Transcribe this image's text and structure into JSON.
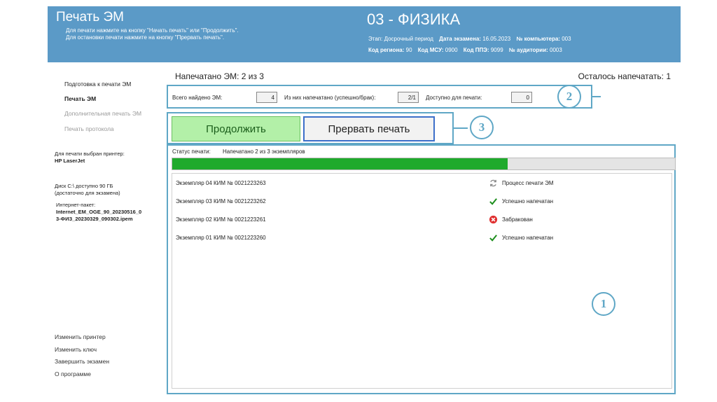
{
  "header": {
    "title": "Печать ЭМ",
    "hint_line1": "Для печати нажмите на кнопку \"Начать печать\" или \"Продолжить\".",
    "hint_line2": "Для остановки печати нажмите на кнопку \"Прервать печать\".",
    "subject": "03 - ФИЗИКА",
    "stage_label": "Этап:",
    "stage_value": "Досрочный период",
    "exam_date_label": "Дата экзамена:",
    "exam_date_value": "16.05.2023",
    "computer_label": "№ компьютера:",
    "computer_value": "003",
    "region_label": "Код региона:",
    "region_value": "90",
    "msu_label": "Код МСУ:",
    "msu_value": "0900",
    "ppe_label": "Код ППЭ:",
    "ppe_value": "9099",
    "auditorium_label": "№ аудитории:",
    "auditorium_value": "0003"
  },
  "sidebar": {
    "steps": [
      {
        "label": "Подготовка к печати ЭМ",
        "state": "normal"
      },
      {
        "label": "Печать ЭМ",
        "state": "active"
      },
      {
        "label": "Дополнительная печать ЭМ",
        "state": "disabled"
      },
      {
        "label": "Печать протокола",
        "state": "disabled"
      }
    ],
    "printer_label": "Для печати выбран принтер:",
    "printer_name": "HP LaserJet",
    "disk_line1": "Диск C:\\ доступно 90 ГБ",
    "disk_line2": "(достаточно для экзамена)",
    "package_label": "Интернет-пакет:",
    "package_line1": "Internet_EM_OGE_90_20230516_0",
    "package_line2": "3-ФИЗ_20230329_090302.ipem",
    "links": [
      "Изменить принтер",
      "Изменить ключ",
      "Завершить экзамен",
      "О программе"
    ]
  },
  "summary": {
    "printed_text": "Напечатано ЭМ:  2  из  3",
    "remaining_text": "Осталось напечатать:  1"
  },
  "counters": {
    "found_label": "Всего найдено ЭМ:",
    "found_value": "4",
    "printed_label": "Из них напечатано (успешно/брак):",
    "printed_value": "2/1",
    "available_label": "Доступно для печати:",
    "available_value": "0"
  },
  "buttons": {
    "continue_label": "Продолжить",
    "abort_label": "Прервать печать"
  },
  "status": {
    "label": "Статус печати:",
    "value": "Напечатано 2 из 3 экземпляров",
    "progress": 0.6667
  },
  "items": [
    {
      "name": "Экземпляр 04   КИМ № 0021223263",
      "status": "Процесс печати ЭМ",
      "icon": "refresh-icon"
    },
    {
      "name": "Экземпляр 03   КИМ № 0021223262",
      "status": "Успешно напечатан",
      "icon": "check-icon"
    },
    {
      "name": "Экземпляр 02   КИМ № 0021223261",
      "status": "Забракован",
      "icon": "error-icon"
    },
    {
      "name": "Экземпляр 01   КИМ № 0021223260",
      "status": "Успешно напечатан",
      "icon": "check-icon"
    }
  ],
  "callouts": [
    "1",
    "2",
    "3"
  ],
  "colors": {
    "header_bg": "#5b9ac7",
    "accent": "#5fa7c6",
    "progress_fill": "#1faa2c",
    "continue_bg": "#b3f0a8",
    "abort_border": "#3c6fc9",
    "check": "#1e8f1e",
    "error": "#e03030"
  }
}
